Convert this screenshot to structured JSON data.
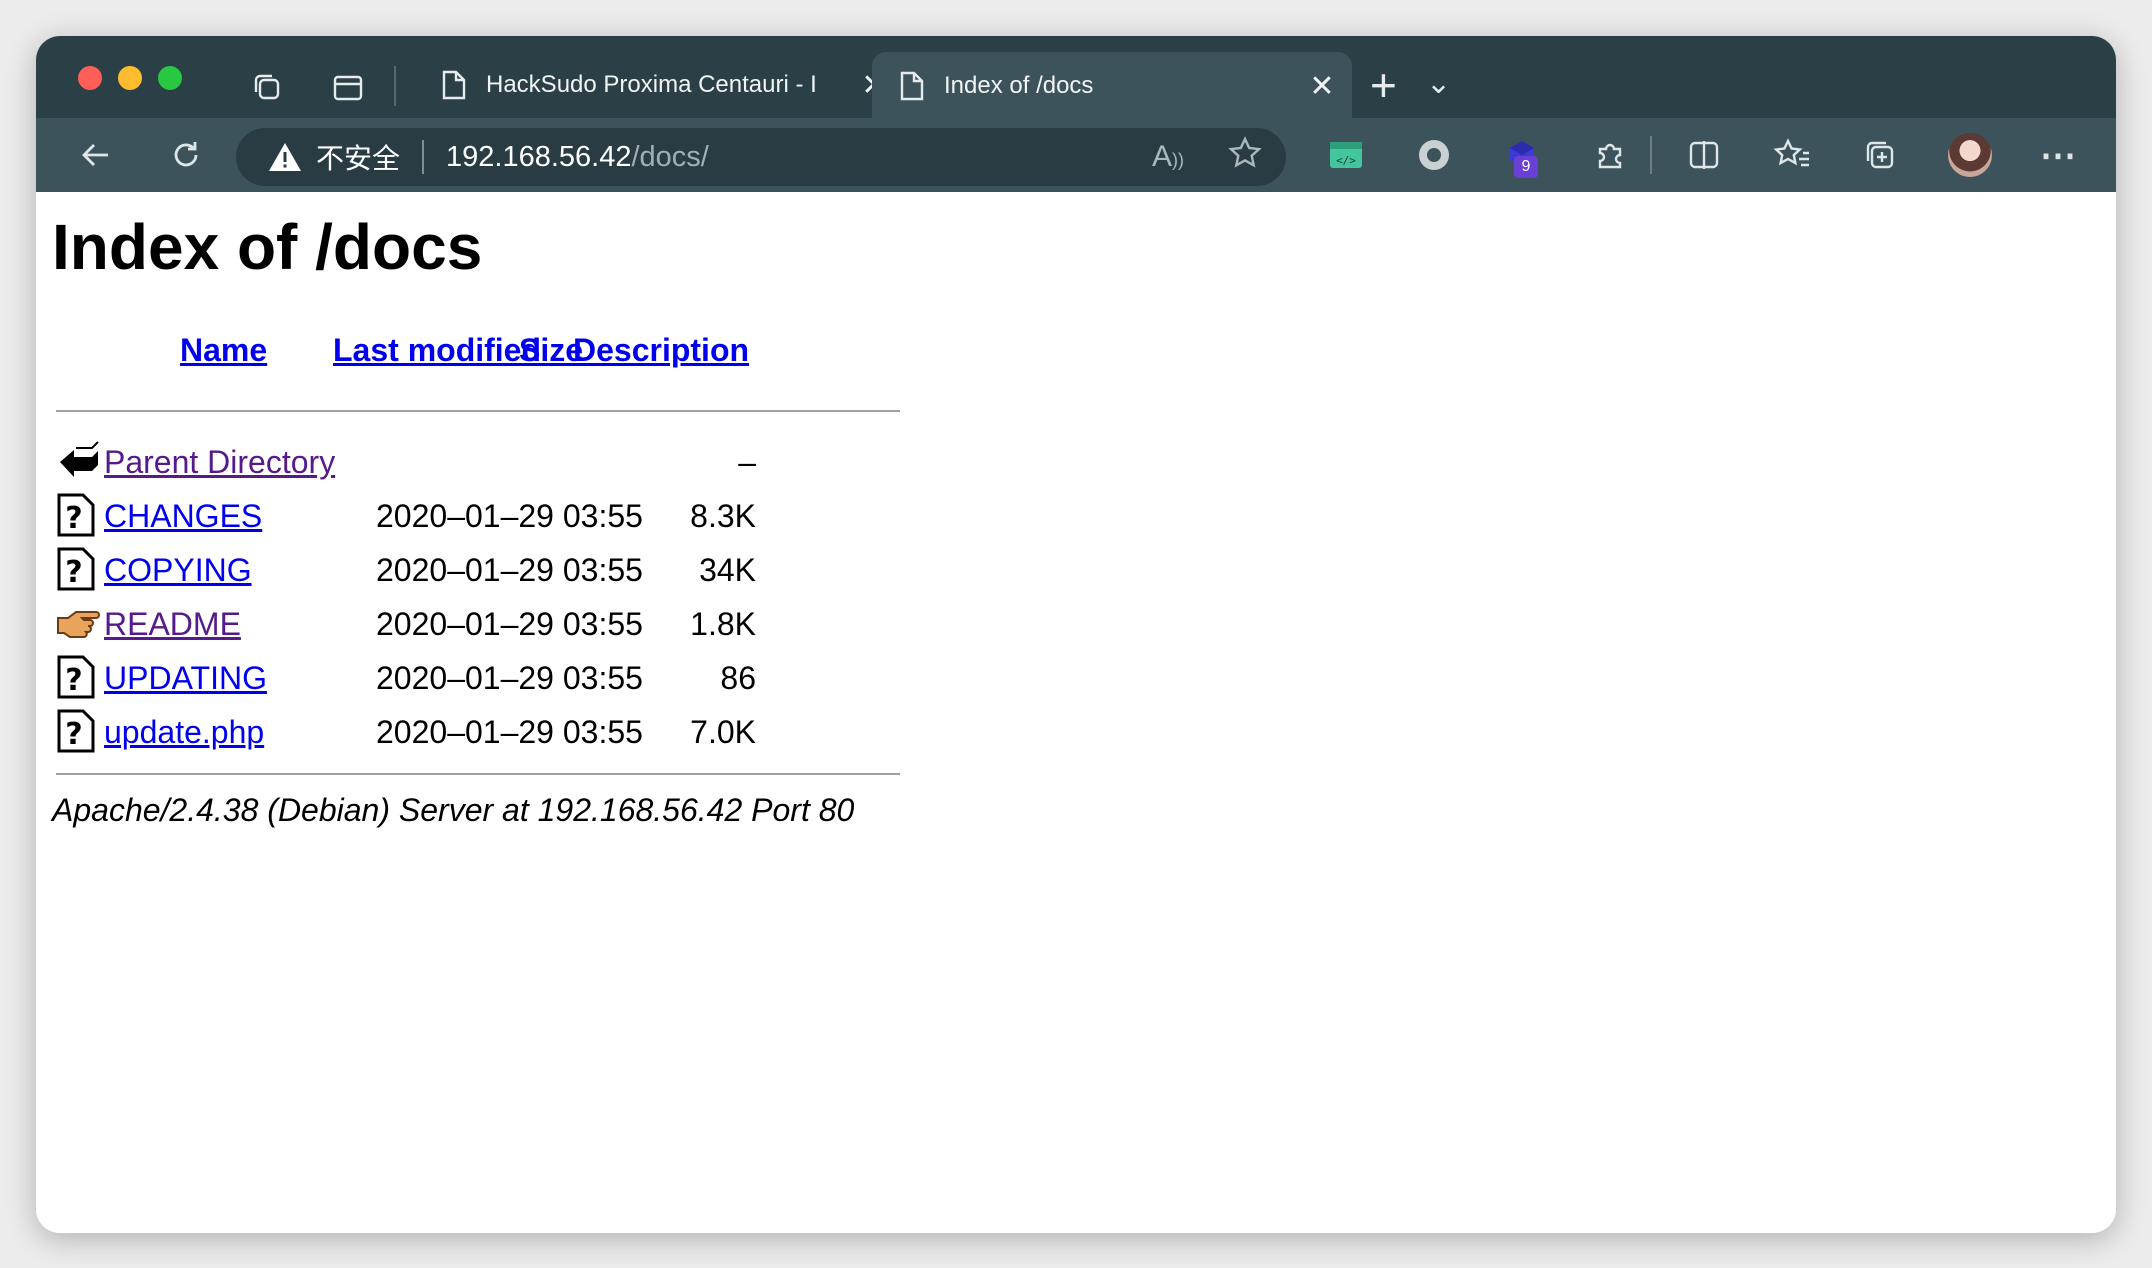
{
  "browser": {
    "tabs": [
      {
        "title": "HackSudo Proxima Centauri - I",
        "active": false,
        "icon": "document-icon"
      },
      {
        "title": "Index of /docs",
        "active": true,
        "icon": "document-icon"
      }
    ],
    "close_glyph": "✕",
    "new_tab_glyph": "+",
    "tab_menu_glyph": "⌄",
    "security_label": "不安全",
    "url_host": "192.168.56.42",
    "url_path": "/docs/",
    "extension_badge": "9",
    "more_glyph": "⋯"
  },
  "page": {
    "heading": "Index of /docs",
    "columns": {
      "name": "Name",
      "last_modified": "Last modified",
      "size": "Size",
      "description": "Description"
    },
    "rows": [
      {
        "icon": "back-arrow-icon",
        "name": "Parent Directory",
        "date": "",
        "size": "–",
        "visited": true
      },
      {
        "icon": "unknown-file-icon",
        "name": "CHANGES",
        "date": "2020–01–29 03:55",
        "size": "8.3K",
        "visited": false
      },
      {
        "icon": "unknown-file-icon",
        "name": "COPYING",
        "date": "2020–01–29 03:55",
        "size": "34K",
        "visited": false
      },
      {
        "icon": "pointing-hand-icon",
        "name": "README",
        "date": "2020–01–29 03:55",
        "size": "1.8K",
        "visited": true
      },
      {
        "icon": "unknown-file-icon",
        "name": "UPDATING",
        "date": "2020–01–29 03:55",
        "size": "86",
        "visited": false
      },
      {
        "icon": "unknown-file-icon",
        "name": "update.php",
        "date": "2020–01–29 03:55",
        "size": "7.0K",
        "visited": false
      }
    ],
    "server_signature": "Apache/2.4.38 (Debian) Server at 192.168.56.42 Port 80"
  },
  "colors": {
    "chrome": "#2b3f47",
    "link": "#0000ee",
    "visited_link": "#551a8b"
  }
}
